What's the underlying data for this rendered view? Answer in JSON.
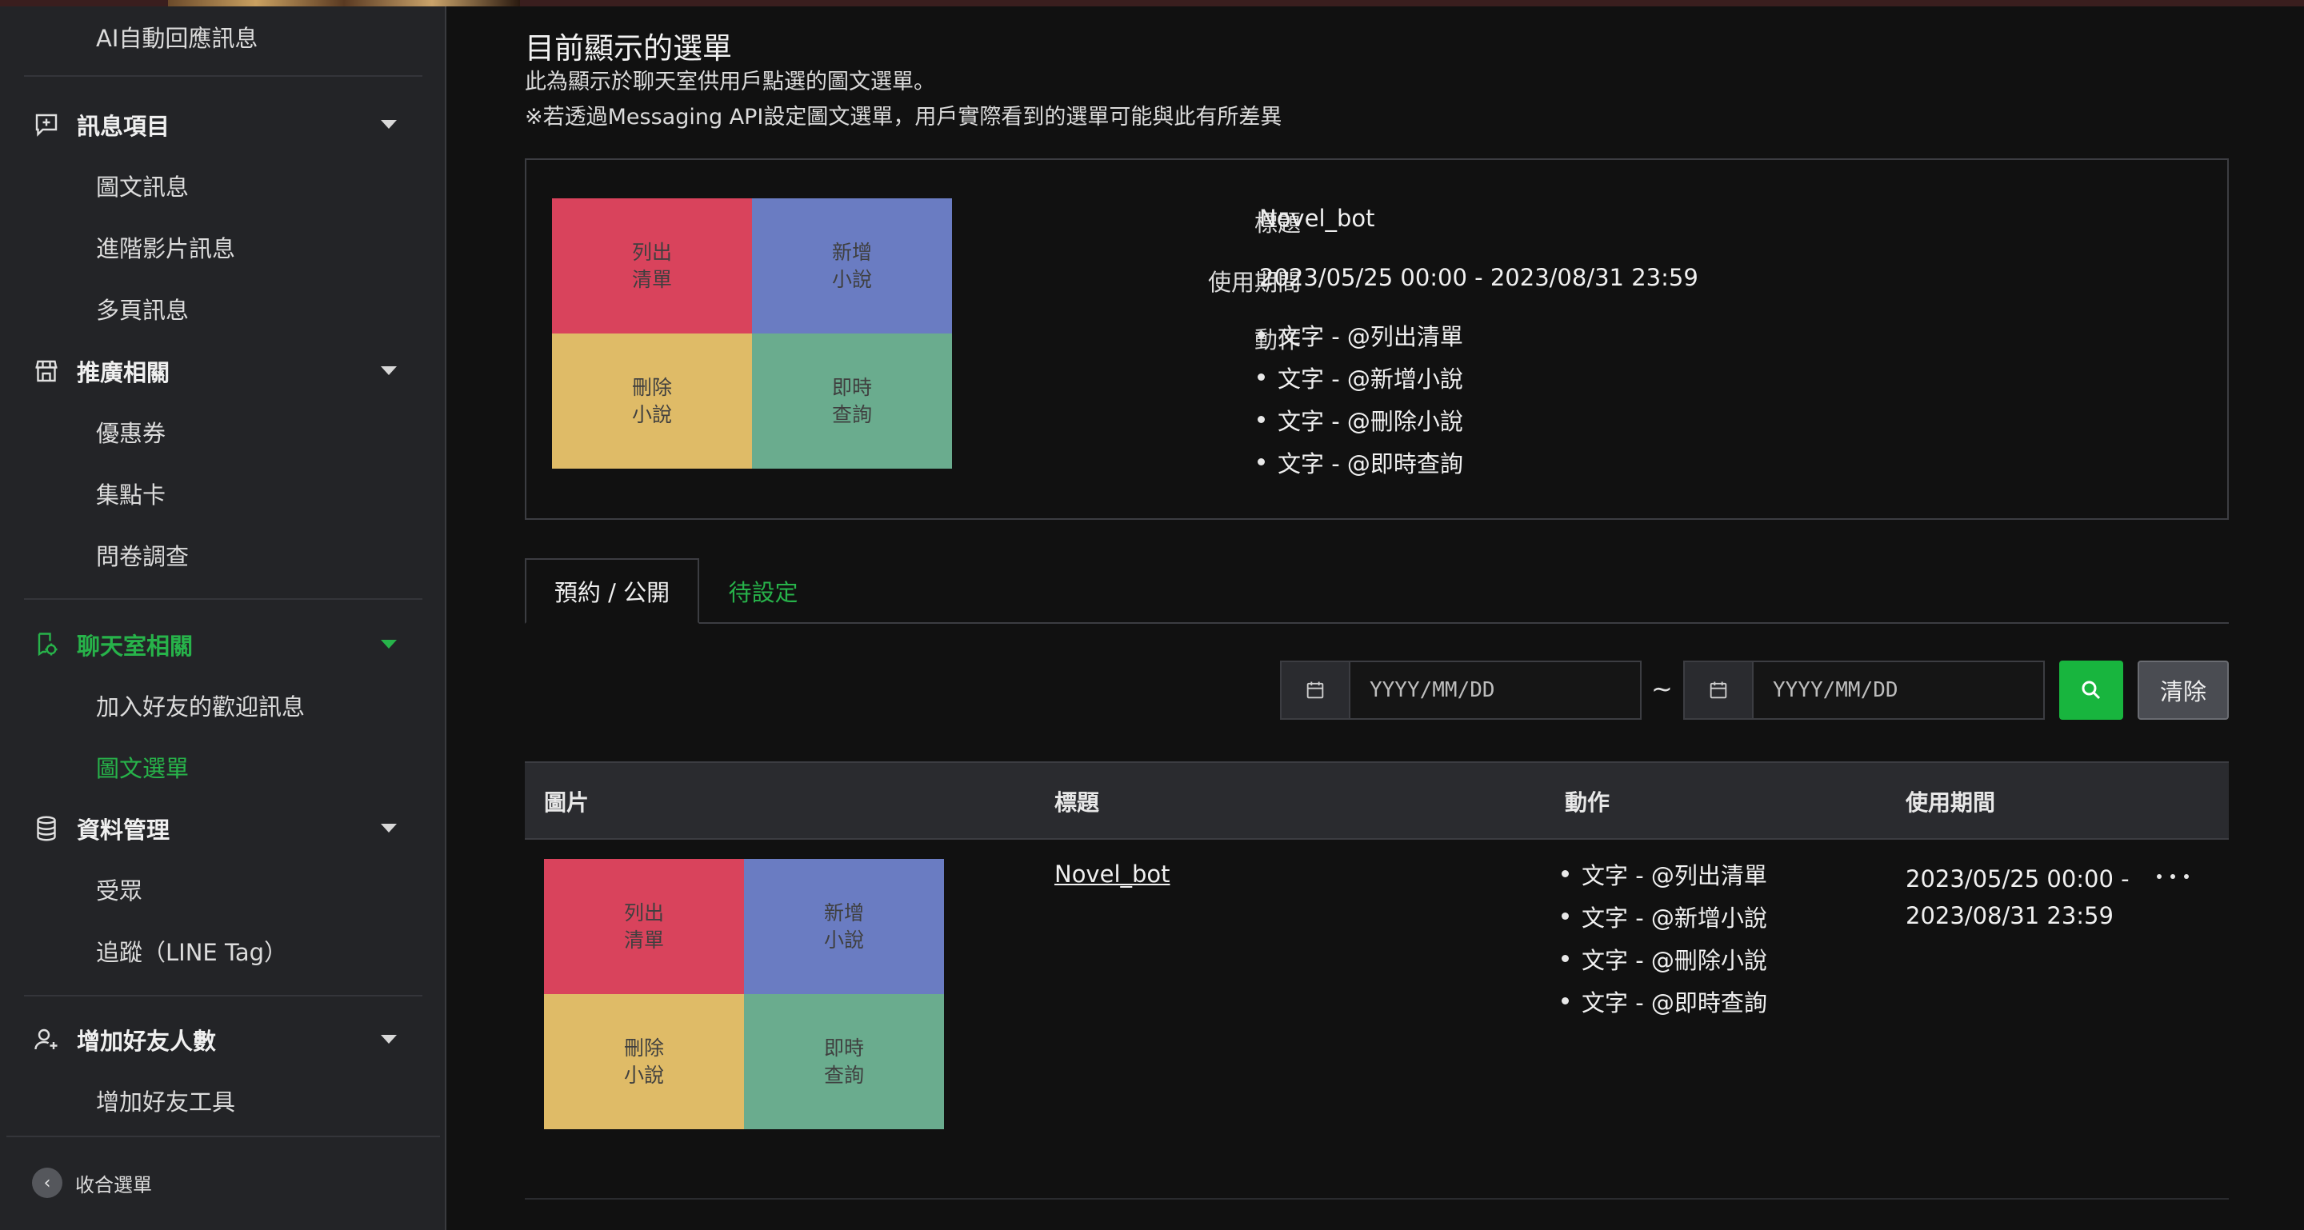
{
  "sidebar": {
    "top_item": "AI自動回應訊息",
    "groups": [
      {
        "label": "訊息項目",
        "icon": "message-plus-icon",
        "items": [
          "圖文訊息",
          "進階影片訊息",
          "多頁訊息"
        ]
      },
      {
        "label": "推廣相關",
        "icon": "store-icon",
        "items": [
          "優惠券",
          "集點卡",
          "問卷調查"
        ]
      },
      {
        "label": "聊天室相關",
        "icon": "chat-settings-icon",
        "items": [
          "加入好友的歡迎訊息",
          "圖文選單"
        ]
      },
      {
        "label": "資料管理",
        "icon": "database-icon",
        "items": [
          "受眾",
          "追蹤（LINE Tag）"
        ]
      },
      {
        "label": "增加好友人數",
        "icon": "add-user-icon",
        "items": [
          "增加好友工具"
        ]
      }
    ],
    "active_group": "聊天室相關",
    "active_item": "圖文選單",
    "collapse_label": "收合選單"
  },
  "page": {
    "title": "目前顯示的選單",
    "desc1": "此為顯示於聊天室供用戶點選的圖文選單。",
    "desc2": "※若透過Messaging API設定圖文選單，用戶實際看到的選單可能與此有所差異"
  },
  "current_menu": {
    "cells": [
      {
        "text": "列出\n清單",
        "color": "#d9435c"
      },
      {
        "text": "新增\n小說",
        "color": "#6a7cc2"
      },
      {
        "text": "刪除\n小說",
        "color": "#dfbb67"
      },
      {
        "text": "即時\n查詢",
        "color": "#6aac8e"
      }
    ],
    "title_key": "標題",
    "title_value": "Novel_bot",
    "period_key": "使用期間",
    "period_value": "2023/05/25 00:00 - 2023/08/31 23:59",
    "actions_key": "動作",
    "actions": [
      "文字 - @列出清單",
      "文字 - @新增小說",
      "文字 - @刪除小說",
      "文字 - @即時查詢"
    ]
  },
  "tabs": {
    "selected": "預約 / 公開",
    "other": "待設定"
  },
  "filter": {
    "start_placeholder": "YYYY/MM/DD",
    "end_placeholder": "YYYY/MM/DD",
    "separator": "~",
    "clear_label": "清除"
  },
  "table": {
    "headers": [
      "圖片",
      "標題",
      "動作",
      "使用期間"
    ],
    "rows": [
      {
        "title": "Novel_bot",
        "actions": [
          "文字 - @列出清單",
          "文字 - @新增小說",
          "文字 - @刪除小說",
          "文字 - @即時查詢"
        ],
        "period_line1": "2023/05/25 00:00 -",
        "period_line2": "2023/08/31 23:59"
      }
    ]
  },
  "colors": {
    "accent_green": "#27b34a",
    "search_green": "#18b53e"
  }
}
